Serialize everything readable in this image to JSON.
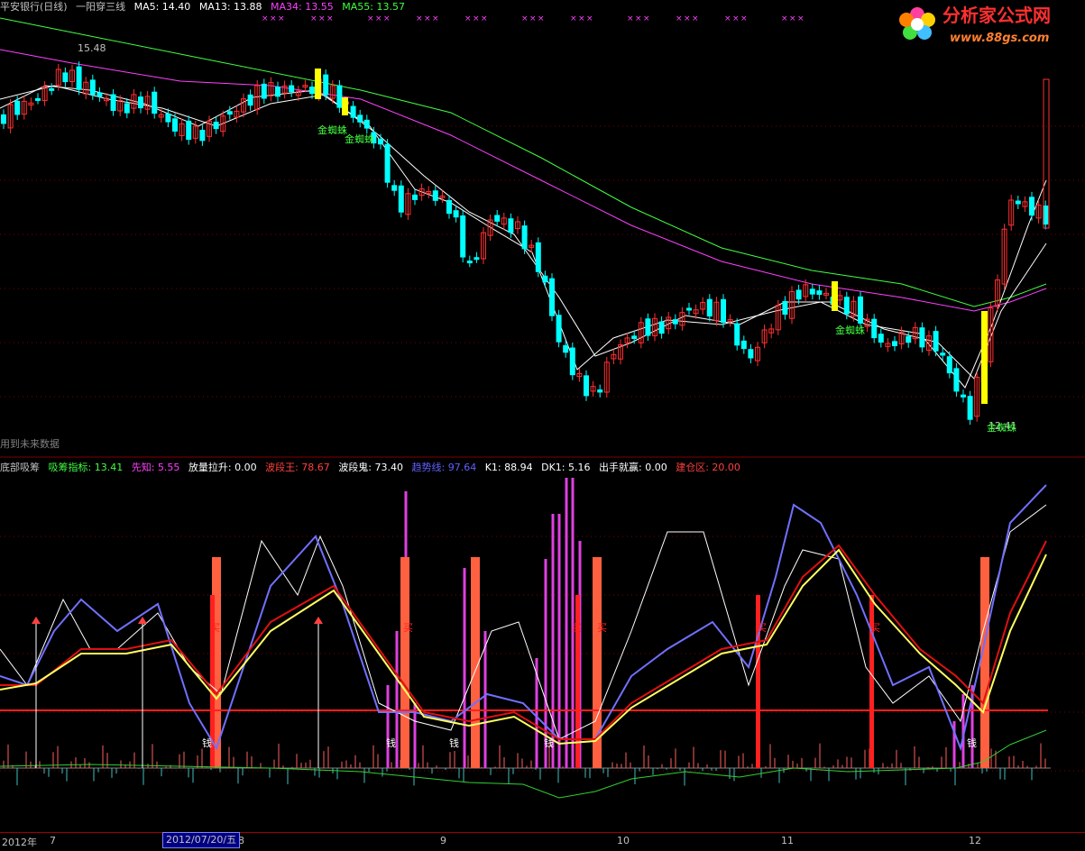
{
  "window": {
    "stock_name": "平安银行(日线)",
    "indicator_name": "一阳穿三线"
  },
  "ma_bar": [
    {
      "label": "MA5: 14.40",
      "color": "#ffffff"
    },
    {
      "label": "MA13: 13.88",
      "color": "#ffffff"
    },
    {
      "label": "MA34: 13.55",
      "color": "#ff40ff"
    },
    {
      "label": "MA55: 13.57",
      "color": "#40ff40"
    }
  ],
  "price_panel": {
    "high_label": "15.48",
    "low_label": "12.41",
    "signal_label": "金蜘蛛",
    "future_data_text": "用到未来数据"
  },
  "indicator_bar": [
    {
      "label": "底部吸筹",
      "color": "#c0c0c0"
    },
    {
      "label": "吸筹指标: 13.41",
      "color": "#40ff40"
    },
    {
      "label": "先知: 5.55",
      "color": "#ff40ff"
    },
    {
      "label": "放量拉升: 0.00",
      "color": "#ffffff"
    },
    {
      "label": "波段王: 78.67",
      "color": "#ff4040"
    },
    {
      "label": "波段鬼: 73.40",
      "color": "#ffffff"
    },
    {
      "label": "趋势线: 97.64",
      "color": "#6060ff"
    },
    {
      "label": "K1: 88.94",
      "color": "#ffffff"
    },
    {
      "label": "DK1: 5.16",
      "color": "#ffffff"
    },
    {
      "label": "出手就赢: 0.00",
      "color": "#ffffff"
    },
    {
      "label": "建仓区: 20.00",
      "color": "#ff4040"
    }
  ],
  "signals": {
    "buy": "买",
    "money": "钱"
  },
  "date_axis": {
    "year": "2012年",
    "months": [
      "7",
      "8",
      "9",
      "10",
      "11",
      "12"
    ],
    "cursor_date": "2012/07/20/五"
  },
  "logo": {
    "title": "分析家公式网",
    "url": "www.88gs.com"
  },
  "colors": {
    "up_candle": "#ff3030",
    "down_candle": "#00ffff",
    "ma5": "#ffffff",
    "ma13": "#ffffff",
    "ma34": "#ff40ff",
    "ma55": "#40ff40",
    "grid": "#800000",
    "signal_bar": "#ffff00"
  }
}
